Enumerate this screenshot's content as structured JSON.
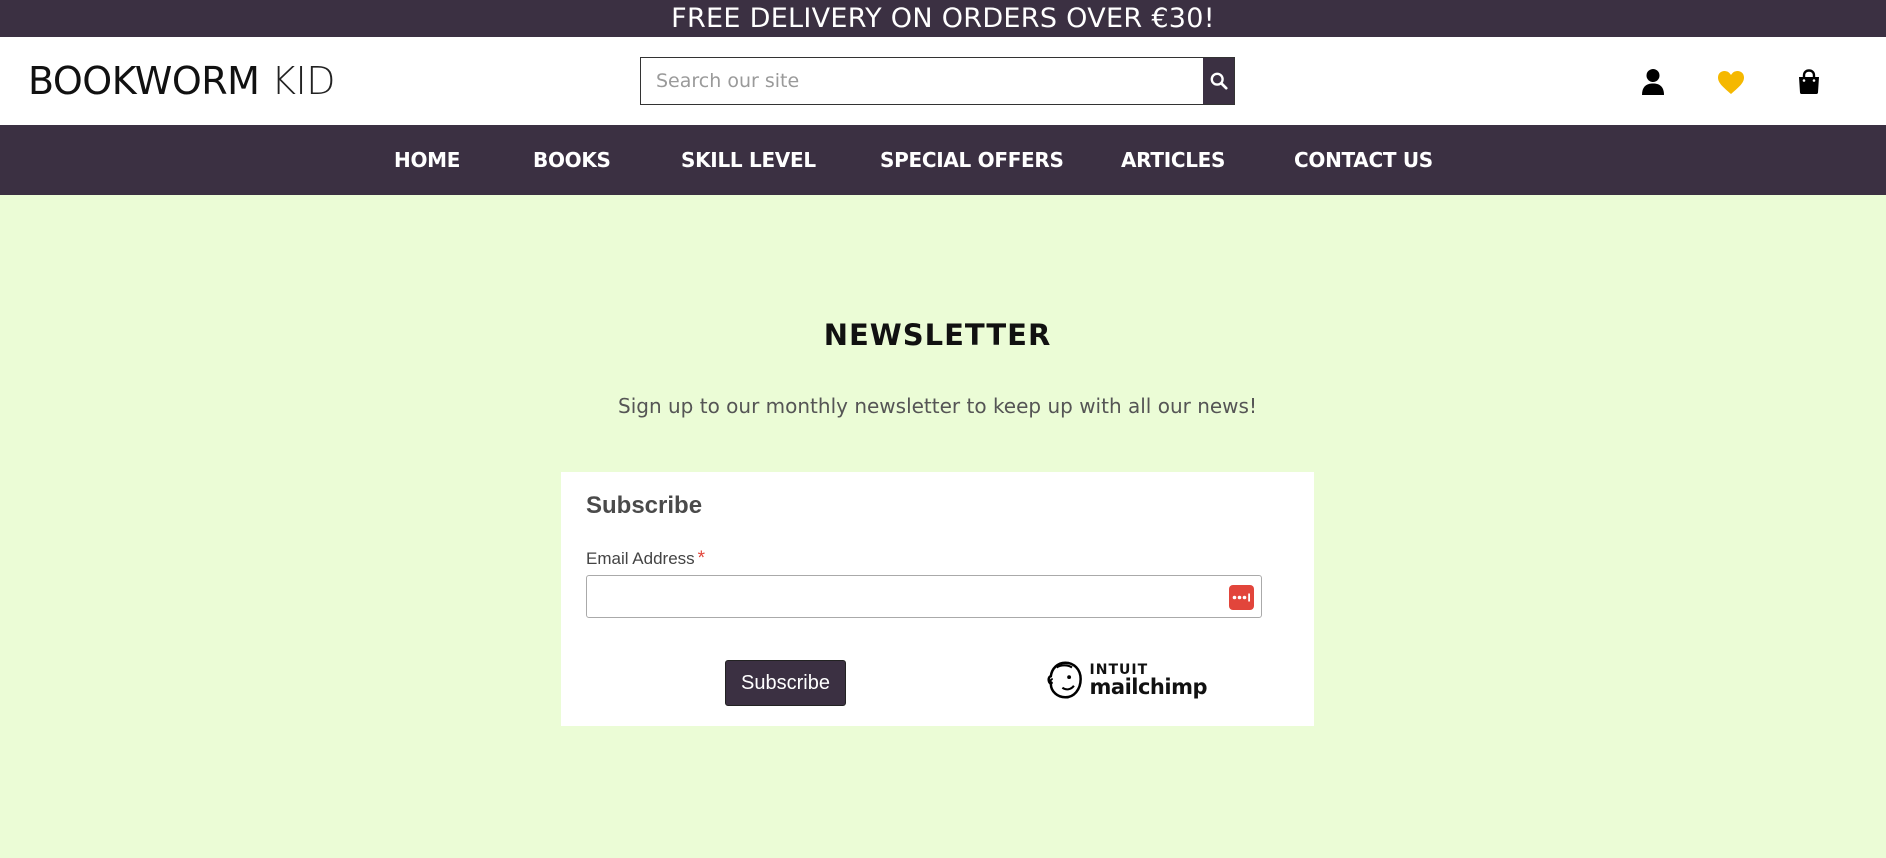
{
  "promo": {
    "text": "FREE DELIVERY ON ORDERS OVER €30!"
  },
  "header": {
    "logo_bold": "BOOKWORM",
    "logo_light": "KID",
    "search_placeholder": "Search our site",
    "icons": [
      "account-icon",
      "wishlist-heart-icon",
      "shopping-bag-icon"
    ],
    "wishlist_color": "#f5b800"
  },
  "nav": {
    "items": [
      {
        "label": "HOME"
      },
      {
        "label": "BOOKS"
      },
      {
        "label": "SKILL LEVEL"
      },
      {
        "label": "SPECIAL OFFERS"
      },
      {
        "label": "ARTICLES"
      },
      {
        "label": "CONTACT US"
      }
    ]
  },
  "newsletter": {
    "title": "NEWSLETTER",
    "subtitle": "Sign up to our monthly newsletter to keep up with all our news!"
  },
  "form": {
    "title": "Subscribe",
    "email_label": "Email Address",
    "required_mark": "*",
    "email_value": "",
    "submit_label": "Subscribe",
    "brand_top": "INTUIT",
    "brand_bottom": "mailchimp"
  },
  "colors": {
    "brand_dark": "#3b3042",
    "page_bg": "#ebfcd6",
    "required": "#e2453b"
  }
}
